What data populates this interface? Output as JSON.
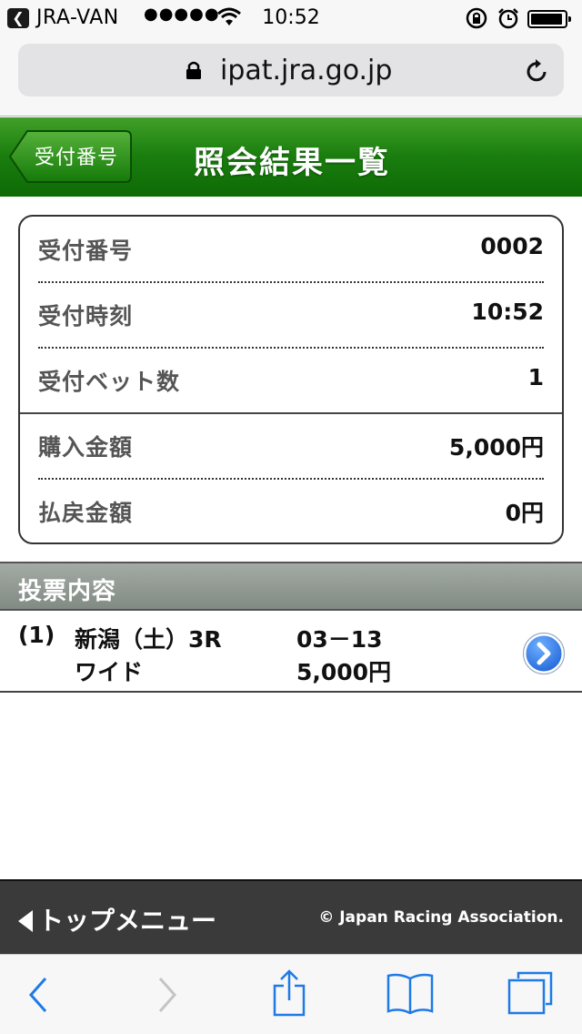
{
  "status_bar": {
    "carrier": "JRA-VAN",
    "signal": "●●●●●",
    "time": "10:52"
  },
  "browser": {
    "url": "ipat.jra.go.jp"
  },
  "header": {
    "back_label": "受付番号",
    "title": "照会結果一覧",
    "accent_color": "#1a7e0e"
  },
  "summary": {
    "rows": [
      {
        "label": "受付番号",
        "value": "0002"
      },
      {
        "label": "受付時刻",
        "value": "10:52"
      },
      {
        "label": "受付ベット数",
        "value": "1"
      },
      {
        "label": "購入金額",
        "value": "5,000円"
      },
      {
        "label": "払戻金額",
        "value": "0円"
      }
    ]
  },
  "section": {
    "title": "投票内容"
  },
  "bet": {
    "index": "(1)",
    "race": "新潟（土）3R",
    "type": "ワイド",
    "combination": "03－13",
    "amount": "5,000円",
    "icon": "chevron-right-circle-icon"
  },
  "footer": {
    "top_menu": "トップメニュー",
    "copyright": "© Japan Racing Association."
  },
  "toolbar": {
    "icons": [
      "back-arrow-icon",
      "forward-arrow-icon",
      "share-icon",
      "bookmarks-icon",
      "tabs-icon"
    ],
    "tint_color": "#1e7ae6"
  }
}
